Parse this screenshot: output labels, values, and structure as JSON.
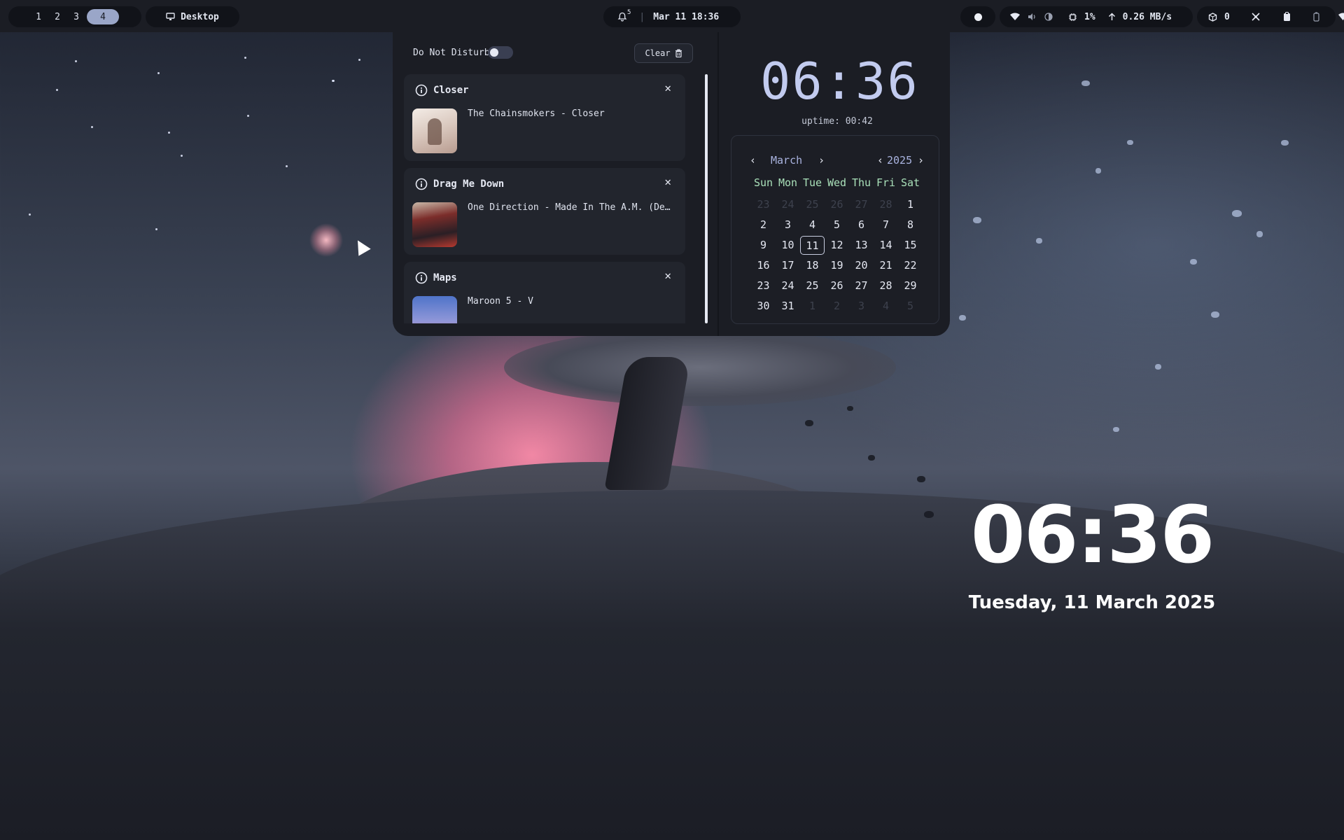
{
  "topbar": {
    "workspaces": [
      "1",
      "2",
      "3",
      "4"
    ],
    "active_workspace": "4",
    "desktop_label": "Desktop",
    "notification_count": "5",
    "datetime": "Mar 11 18:36",
    "cpu": "1%",
    "net_speed": "0.26 MB/s",
    "updates": "0"
  },
  "notifications": {
    "dnd_label": "Do Not Disturb",
    "dnd_enabled": false,
    "clear_label": "Clear",
    "items": [
      {
        "title": "Closer",
        "body": "The Chainsmokers - Closer"
      },
      {
        "title": "Drag Me Down",
        "body": "One Direction - Made In The A.M. (De…"
      },
      {
        "title": "Maps",
        "body": "Maroon 5 - V"
      }
    ]
  },
  "clock": {
    "time": "06:36",
    "uptime": "uptime: 00:42"
  },
  "calendar": {
    "month": "March",
    "year": "2025",
    "days_of_week": [
      "Sun",
      "Mon",
      "Tue",
      "Wed",
      "Thu",
      "Fri",
      "Sat"
    ],
    "today": "11",
    "weeks": [
      [
        "23",
        "24",
        "25",
        "26",
        "27",
        "28",
        "1"
      ],
      [
        "2",
        "3",
        "4",
        "5",
        "6",
        "7",
        "8"
      ],
      [
        "9",
        "10",
        "11",
        "12",
        "13",
        "14",
        "15"
      ],
      [
        "16",
        "17",
        "18",
        "19",
        "20",
        "21",
        "22"
      ],
      [
        "23",
        "24",
        "25",
        "26",
        "27",
        "28",
        "29"
      ],
      [
        "30",
        "31",
        "1",
        "2",
        "3",
        "4",
        "5"
      ]
    ]
  },
  "desktop": {
    "time": "06:36",
    "date": "Tuesday, 11 March 2025"
  },
  "colors": {
    "accent": "#c2cbef",
    "weekday": "#a9e0b9",
    "panel_bg": "#1b1d24"
  }
}
